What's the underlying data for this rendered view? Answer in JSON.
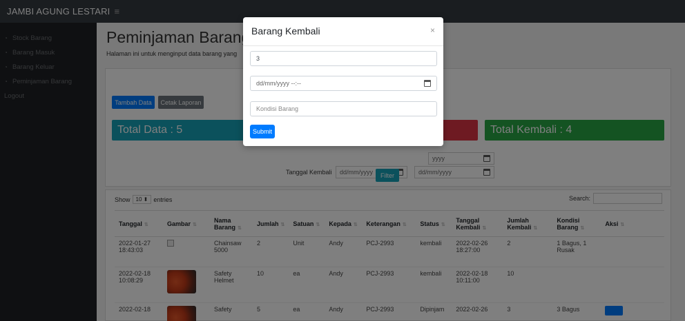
{
  "brand": "JAMBI AGUNG LESTARI",
  "sidebar": {
    "items": [
      {
        "label": "Stock Barang"
      },
      {
        "label": "Barang Masuk"
      },
      {
        "label": "Barang Keluar"
      },
      {
        "label": "Peminjaman Barang"
      }
    ],
    "logout": "Logout"
  },
  "page": {
    "title": "Peminjaman Barang",
    "subtitle": "Halaman ini untuk menginput data barang yang"
  },
  "buttons": {
    "tambah": "Tambah Data",
    "cetak": "Cetak Laporan",
    "filter": "Filter"
  },
  "stats": {
    "total": "Total Data : 5",
    "kembali": "Total Kembali : 4"
  },
  "filter": {
    "tanggal_kembali_label": "Tanggal Kembali",
    "date_placeholder": "dd/mm/yyyy",
    "partial_placeholder": "yyyy"
  },
  "table_controls": {
    "show": "Show",
    "entries_value": "10",
    "entries": "entries",
    "search": "Search:"
  },
  "table": {
    "headers": [
      "Tanggal",
      "Gambar",
      "Nama Barang",
      "Jumlah",
      "Satuan",
      "Kepada",
      "Keterangan",
      "Status",
      "Tanggal Kembali",
      "Jumlah Kembali",
      "Kondisi Barang",
      "Aksi"
    ],
    "rows": [
      {
        "tanggal": "2022-01-27 18:43:03",
        "nama": "Chainsaw 5000",
        "jumlah": "2",
        "satuan": "Unit",
        "kepada": "Andy",
        "keterangan": "PCJ-2993",
        "status": "kembali",
        "tgl_kembali": "2022-02-26 18:27:00",
        "jml_kembali": "2",
        "kondisi": "1 Bagus, 1 Rusak"
      },
      {
        "tanggal": "2022-02-18 10:08:29",
        "nama": "Safety Helmet",
        "jumlah": "10",
        "satuan": "ea",
        "kepada": "Andy",
        "keterangan": "PCJ-2993",
        "status": "kembali",
        "tgl_kembali": "2022-02-18 10:11:00",
        "jml_kembali": "10",
        "kondisi": ""
      },
      {
        "tanggal": "2022-02-18",
        "nama": "Safety",
        "jumlah": "5",
        "satuan": "ea",
        "kepada": "Andy",
        "keterangan": "PCJ-2993",
        "status": "Dipinjam",
        "tgl_kembali": "2022-02-26",
        "jml_kembali": "3",
        "kondisi": "3 Bagus"
      }
    ]
  },
  "modal": {
    "title": "Barang Kembali",
    "close": "×",
    "qty_value": "3",
    "date_placeholder": "dd/mm/yyyy --:--",
    "kondisi_placeholder": "Kondisi Barang",
    "submit": "Submit"
  }
}
